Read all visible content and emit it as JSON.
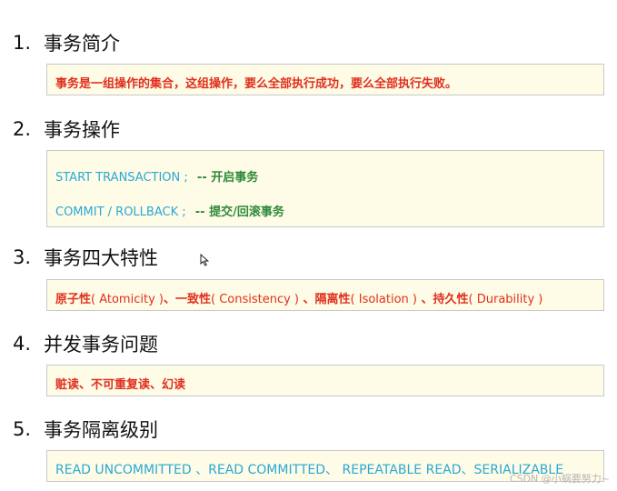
{
  "sections": [
    {
      "number": "1.",
      "title": "事务简介",
      "lines": [
        {
          "text": "事务是一组操作的集合，这组操作，要么全部执行成功，要么全部执行失败。"
        }
      ]
    },
    {
      "number": "2.",
      "title": "事务操作",
      "lines": [
        {
          "code": "START  TRANSACTION ;",
          "comment": "-- 开启事务"
        },
        {
          "code": "COMMIT / ROLLBACK ;",
          "comment": "-- 提交/回滚事务"
        }
      ]
    },
    {
      "number": "3.",
      "title": "事务四大特性",
      "lines": [
        {
          "parts": [
            "原子性",
            "( Atomicity )",
            "、一致性",
            "( Consistency )",
            " 、隔离性",
            "( Isolation )",
            " 、持久性",
            "( Durability )"
          ]
        }
      ]
    },
    {
      "number": "4.",
      "title": "并发事务问题",
      "lines": [
        {
          "text": "赃读、不可重复读、幻读"
        }
      ]
    },
    {
      "number": "5.",
      "title": "事务隔离级别",
      "lines": [
        {
          "text": "READ UNCOMMITTED 、READ COMMITTED、 REPEATABLE READ、SERIALIZABLE"
        }
      ]
    }
  ],
  "watermark": "CSDN @小蜗要努力~",
  "colors": {
    "red": "#e0301e",
    "blue": "#2aa9d6",
    "green": "#2e8b3a",
    "box_bg": "#fefbe6"
  },
  "icons": {
    "cursor": "mouse-pointer-icon"
  }
}
